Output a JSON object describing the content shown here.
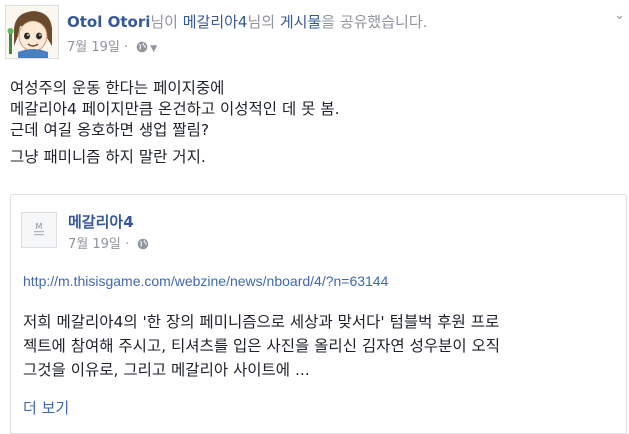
{
  "post": {
    "author_name": "Otol Otori",
    "header_suffix_1": "님이 ",
    "page_name": "메갈리아4",
    "header_suffix_2": "님의 ",
    "post_link": "게시물",
    "header_suffix_3": "을 공유했습니다.",
    "date": "7월 19일",
    "separator": "·",
    "privacy_icon": "globe-icon",
    "body_lines": [
      "여성주의 운동 한다는 페이지중에",
      "메갈리아4 페이지만큼 온건하고 이성적인 데 못 봄.",
      "근데 여길 옹호하면 생업 짤림?",
      "그냥 패미니즘 하지 말란 거지."
    ]
  },
  "shared": {
    "page_name": "메갈리아4",
    "date": "7월 19일",
    "separator": "·",
    "link_url": "http://m.thisisgame.com/webzine/news/nboard/4/?n=63144",
    "excerpt_lines": [
      "저희 메갈리아4의 '한 장의 페미니즘으로 세상과 맞서다' 텀블벅 후원 프로",
      "젝트에 참여해 주시고, 티셔츠를 입은 사진을 올리신 김자연 성우분이 오직",
      "그것을 이유로, 그리고 메갈리아 사이트에 ..."
    ],
    "see_more": "더 보기"
  },
  "colors": {
    "link_blue": "#365899",
    "url_blue": "#4267b2",
    "meta_gray": "#90949c",
    "text": "#1d2129",
    "border": "#dddfe2"
  }
}
